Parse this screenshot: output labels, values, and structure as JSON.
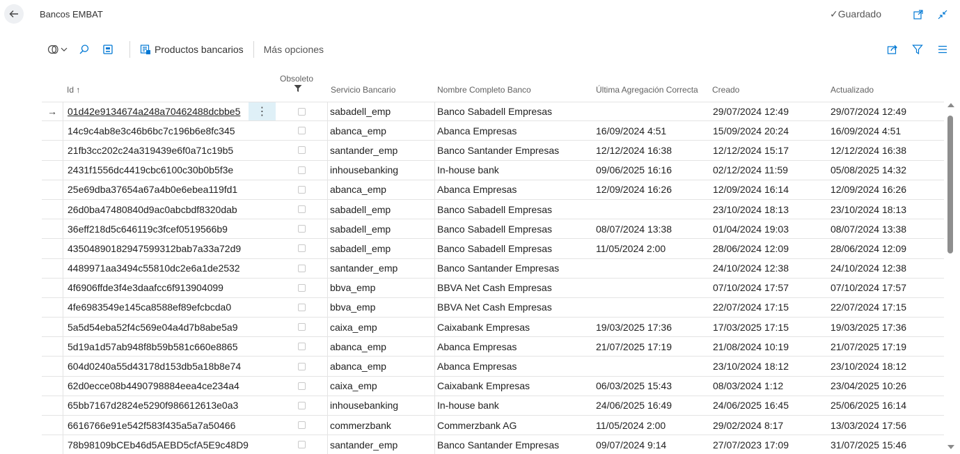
{
  "header": {
    "title": "Bancos EMBAT",
    "saved_label": "✓Guardado"
  },
  "icons": {
    "back": "arrow-left-icon",
    "open_new": "open-in-new-window-icon",
    "collapse": "collapse-icon",
    "views": "views-icon",
    "search": "search-icon",
    "edit_list": "edit-list-icon",
    "bank_products": "bank-products-icon",
    "share": "share-icon",
    "filter": "filter-icon",
    "list_view": "list-view-icon"
  },
  "toolbar": {
    "products_label": "Productos bancarios",
    "more_label": "Más opciones"
  },
  "columns": {
    "id": "Id",
    "id_sort": "↑",
    "obsolete": "Obsoleto",
    "service": "Servicio Bancario",
    "full_name": "Nombre Completo Banco",
    "last_agg": "Última Agregación Correcta",
    "created": "Creado",
    "updated": "Actualizado"
  },
  "colors": {
    "selected_cell": "#dff0f7",
    "border": "#e4e4e4",
    "accent": "#0078d4"
  },
  "rows": [
    {
      "id": "01d42e9134674a248a70462488dcbbe5",
      "service": "sabadell_emp",
      "name": "Banco Sabadell Empresas",
      "last": "",
      "created": "29/07/2024 12:49",
      "updated": "29/07/2024 12:49"
    },
    {
      "id": "14c9c4ab8e3c46b6bc7c196b6e8fc345",
      "service": "abanca_emp",
      "name": "Abanca Empresas",
      "last": "16/09/2024 4:51",
      "created": "15/09/2024 20:24",
      "updated": "16/09/2024 4:51"
    },
    {
      "id": "21fb3cc202c24a319439e6f0a71c19b5",
      "service": "santander_emp",
      "name": "Banco Santander Empresas",
      "last": "12/12/2024 16:38",
      "created": "12/12/2024 15:17",
      "updated": "12/12/2024 16:38"
    },
    {
      "id": "2431f1556dc4419cbc6100c30b0b5f3e",
      "service": "inhousebanking",
      "name": "In-house bank",
      "last": "09/06/2025 16:16",
      "created": "02/12/2024 11:59",
      "updated": "05/08/2025 14:32"
    },
    {
      "id": "25e69dba37654a67a4b0e6ebea119fd1",
      "service": "abanca_emp",
      "name": "Abanca Empresas",
      "last": "12/09/2024 16:26",
      "created": "12/09/2024 16:14",
      "updated": "12/09/2024 16:26"
    },
    {
      "id": "26d0ba47480840d9ac0abcbdf8320dab",
      "service": "sabadell_emp",
      "name": "Banco Sabadell Empresas",
      "last": "",
      "created": "23/10/2024 18:13",
      "updated": "23/10/2024 18:13"
    },
    {
      "id": "36eff218d5c646119c3fcef0519566b9",
      "service": "sabadell_emp",
      "name": "Banco Sabadell Empresas",
      "last": "08/07/2024 13:38",
      "created": "01/04/2024 19:03",
      "updated": "08/07/2024 13:38"
    },
    {
      "id": "43504890182947599312bab7a33a72d9",
      "service": "sabadell_emp",
      "name": "Banco Sabadell Empresas",
      "last": "11/05/2024 2:00",
      "created": "28/06/2024 12:09",
      "updated": "28/06/2024 12:09"
    },
    {
      "id": "4489971aa3494c55810dc2e6a1de2532",
      "service": "santander_emp",
      "name": "Banco Santander Empresas",
      "last": "",
      "created": "24/10/2024 12:38",
      "updated": "24/10/2024 12:38"
    },
    {
      "id": "4f6906ffde3f4e3daafcc6f913904099",
      "service": "bbva_emp",
      "name": "BBVA Net Cash Empresas",
      "last": "",
      "created": "07/10/2024 17:57",
      "updated": "07/10/2024 17:57"
    },
    {
      "id": "4fe6983549e145ca8588ef89efcbcda0",
      "service": "bbva_emp",
      "name": "BBVA Net Cash Empresas",
      "last": "",
      "created": "22/07/2024 17:15",
      "updated": "22/07/2024 17:15"
    },
    {
      "id": "5a5d54eba52f4c569e04a4d7b8abe5a9",
      "service": "caixa_emp",
      "name": "Caixabank Empresas",
      "last": "19/03/2025 17:36",
      "created": "17/03/2025 17:15",
      "updated": "19/03/2025 17:36"
    },
    {
      "id": "5d19a1d57ab948f8b59b581c660e8865",
      "service": "abanca_emp",
      "name": "Abanca Empresas",
      "last": "21/07/2025 17:19",
      "created": "21/08/2024 10:19",
      "updated": "21/07/2025 17:19"
    },
    {
      "id": "604d0240a55d43178d153db5a18b8e74",
      "service": "abanca_emp",
      "name": "Abanca Empresas",
      "last": "",
      "created": "23/10/2024 18:12",
      "updated": "23/10/2024 18:12"
    },
    {
      "id": "62d0ecce08b4490798884eea4ce234a4",
      "service": "caixa_emp",
      "name": "Caixabank Empresas",
      "last": "06/03/2025 15:43",
      "created": "08/03/2024 1:12",
      "updated": "23/04/2025 10:26"
    },
    {
      "id": "65bb7167d2824e5290f986612613e0a3",
      "service": "inhousebanking",
      "name": "In-house bank",
      "last": "24/06/2025 16:49",
      "created": "24/06/2025 16:45",
      "updated": "25/06/2025 16:14"
    },
    {
      "id": "6616766e91e542f583f435a5a7a50466",
      "service": "commerzbank",
      "name": "Commerzbank AG",
      "last": "11/05/2024 2:00",
      "created": "29/02/2024 8:17",
      "updated": "13/03/2024 17:56"
    },
    {
      "id": "78b98109bCEb46d5AEBD5cfA5E9c48D9",
      "service": "santander_emp",
      "name": "Banco Santander Empresas",
      "last": "09/07/2024 9:14",
      "created": "27/07/2023 17:09",
      "updated": "31/07/2025 15:46"
    }
  ]
}
